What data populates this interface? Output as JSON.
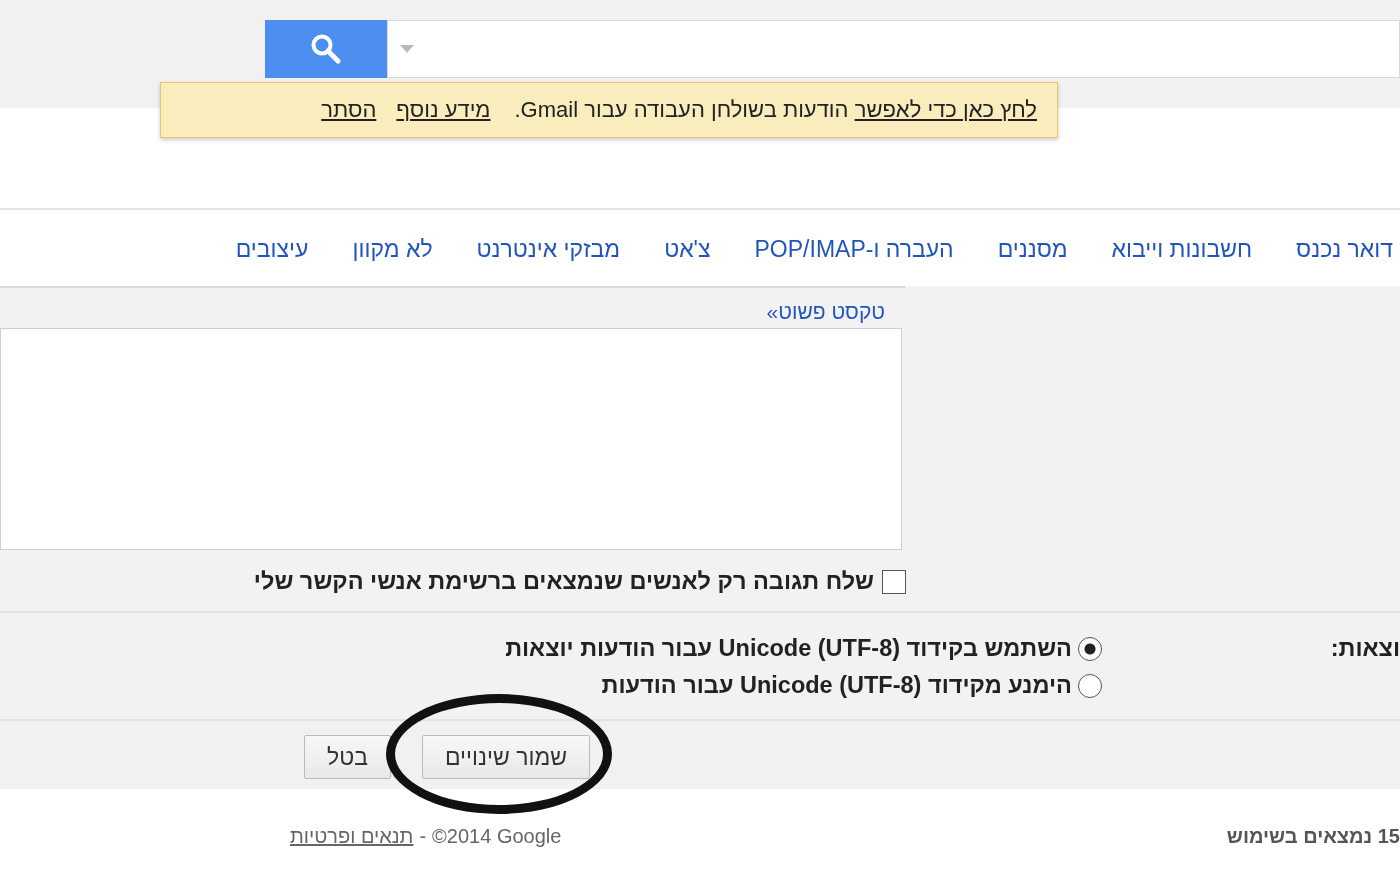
{
  "notice": {
    "link_text": "לחץ כאן כדי לאפשר",
    "text": "הודעות בשולחן העבודה עבור Gmail.",
    "links": [
      "מידע נוסף",
      "הסתר"
    ]
  },
  "tabs": [
    {
      "label": "דואר נכנס",
      "selected": false
    },
    {
      "label": "חשבונות וייבוא",
      "selected": false
    },
    {
      "label": "מסננים",
      "selected": false
    },
    {
      "label": "העברה ו-POP/IMAP",
      "selected": false
    },
    {
      "label": "צ'אט",
      "selected": false
    },
    {
      "label": "מבזקי אינטרנט",
      "selected": false
    },
    {
      "label": "לא מקוון",
      "selected": false
    },
    {
      "label": "עיצובים",
      "selected": false
    }
  ],
  "editor": {
    "mode_link": "טקסט פשוט»"
  },
  "contacts_only": {
    "label": "שלח תגובה רק לאנשים שנמצאים ברשימת אנשי הקשר שלי",
    "checked": false
  },
  "encoding": {
    "label": "וצאות:",
    "options": [
      {
        "label": "השתמש בקידוד Unicode (UTF-8) עבור הודעות יוצאות",
        "selected": true
      },
      {
        "label": "הימנע מקידוד Unicode (UTF-8) עבור הודעות",
        "selected": false
      }
    ]
  },
  "buttons": [
    "שמור שינויים",
    "בטל"
  ],
  "footer": {
    "storage": "15 נמצאים בשימוש",
    "copyright": "©2014 Google",
    "separator": "-",
    "terms": "תנאים ופרטיות"
  }
}
